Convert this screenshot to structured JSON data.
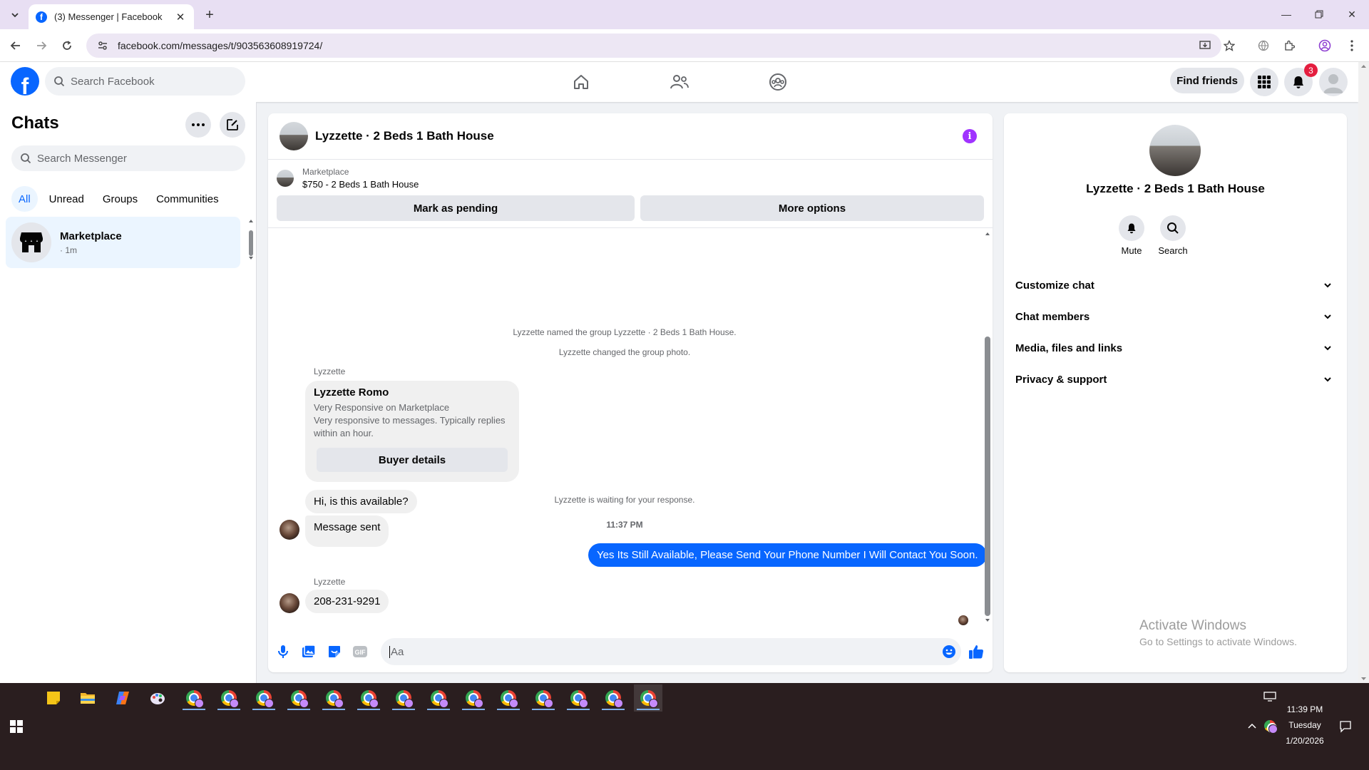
{
  "browser": {
    "tab_title": "(3) Messenger | Facebook",
    "url": "facebook.com/messages/t/903563608919724/"
  },
  "header": {
    "search_placeholder": "Search Facebook",
    "find_friends": "Find friends",
    "notification_count": "3",
    "brand_color": "#0866ff"
  },
  "sidebar": {
    "title": "Chats",
    "search_placeholder": "Search Messenger",
    "filters": [
      "All",
      "Unread",
      "Groups",
      "Communities"
    ],
    "chats": [
      {
        "name": "Marketplace",
        "time": "· 1m"
      }
    ]
  },
  "chat": {
    "title": "Lyzzette · 2 Beds 1 Bath House",
    "marketplace_label": "Marketplace",
    "listing": "$750 - 2 Beds 1 Bath House",
    "mark_pending": "Mark as pending",
    "more_options": "More options",
    "system_1": "Lyzzette named the group Lyzzette · 2 Beds 1 Bath House.",
    "system_2": "Lyzzette changed the group photo.",
    "sender_1": "Lyzzette",
    "card": {
      "name": "Lyzzette Romo",
      "line1": "Very Responsive on Marketplace",
      "line2": "Very responsive to messages. Typically replies within an hour.",
      "button": "Buyer details"
    },
    "msg_1": "Hi, is this available?",
    "msg_2": "Message sent",
    "waiting": "Lyzzette is waiting for your response.",
    "time": "11:37 PM",
    "out_msg": "Yes Its Still Available, Please Send Your Phone Number I Will Contact You Soon.",
    "sender_2": "Lyzzette",
    "msg_3": "208-231-9291",
    "composer_placeholder": "Aa"
  },
  "details": {
    "title": "Lyzzette · 2 Beds 1 Bath House",
    "mute": "Mute",
    "search": "Search",
    "sections": [
      "Customize chat",
      "Chat members",
      "Media, files and links",
      "Privacy & support"
    ]
  },
  "watermark": {
    "line1": "Activate Windows",
    "line2": "Go to Settings to activate Windows."
  },
  "taskbar": {
    "time": "11:39 PM",
    "day": "Tuesday",
    "date": "1/20/2026"
  }
}
